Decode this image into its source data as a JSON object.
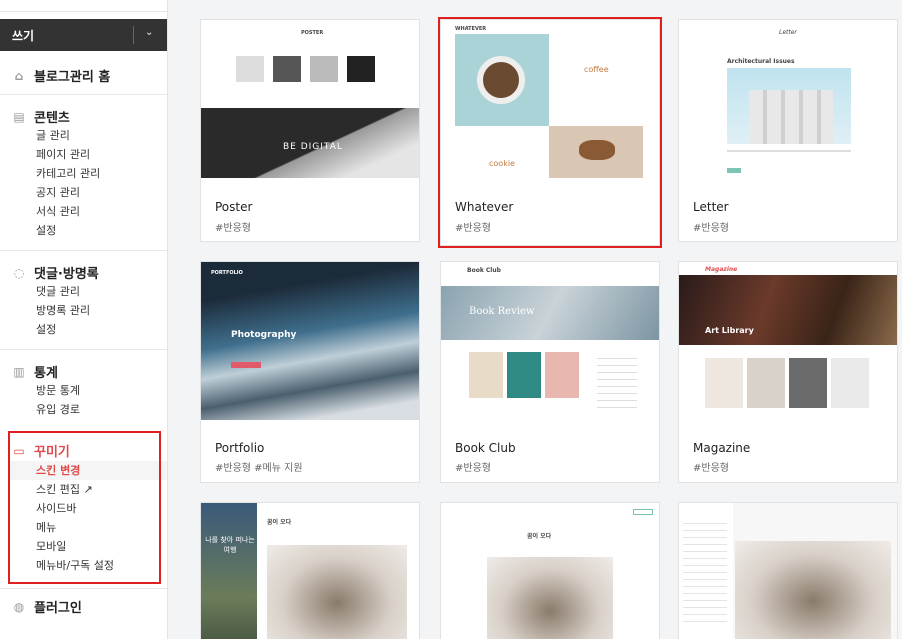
{
  "sidebar": {
    "write_label": "쓰기",
    "home_label": "블로그관리 홈",
    "sections": [
      {
        "title": "콘텐츠",
        "icon": "document-icon",
        "items": [
          "글 관리",
          "페이지 관리",
          "카테고리 관리",
          "공지 관리",
          "서식 관리",
          "설정"
        ]
      },
      {
        "title": "댓글·방명록",
        "icon": "comment-icon",
        "items": [
          "댓글 관리",
          "방명록 관리",
          "설정"
        ]
      },
      {
        "title": "통계",
        "icon": "chart-icon",
        "items": [
          "방문 통계",
          "유입 경로"
        ]
      },
      {
        "title": "꾸미기",
        "icon": "layout-icon",
        "items": [
          "스킨 변경",
          "스킨 편집 ↗",
          "사이드바",
          "메뉴",
          "모바일",
          "메뉴바/구독 설정"
        ]
      },
      {
        "title": "플러그인",
        "icon": "plugin-icon",
        "items": []
      }
    ]
  },
  "skins": [
    {
      "name": "Poster",
      "tag": "#반응형",
      "thumb_text": "BE DIGITAL",
      "header": "POSTER"
    },
    {
      "name": "Whatever",
      "tag": "#반응형",
      "thumb_text": "coffee",
      "thumb_text2": "cookie",
      "header": "WHATEVER"
    },
    {
      "name": "Letter",
      "tag": "#반응형",
      "thumb_text": "Architectural Issues",
      "header": "Letter"
    },
    {
      "name": "Portfolio",
      "tag": "#반응형   #메뉴 지원",
      "thumb_text": "Photography",
      "header": "PORTFOLIO"
    },
    {
      "name": "Book Club",
      "tag": "#반응형",
      "thumb_text": "Book Review",
      "header": "Book Club"
    },
    {
      "name": "Magazine",
      "tag": "#반응형",
      "thumb_text": "Art Library",
      "header": "Magazine"
    },
    {
      "thumb_text": "나를 찾아 떠나는 여행",
      "thumb_title": "꿈이 오다"
    },
    {
      "thumb_title": "꿈이 오다"
    },
    {}
  ],
  "colors": {
    "accent": "#e04c4c",
    "selection": "#e02020"
  }
}
